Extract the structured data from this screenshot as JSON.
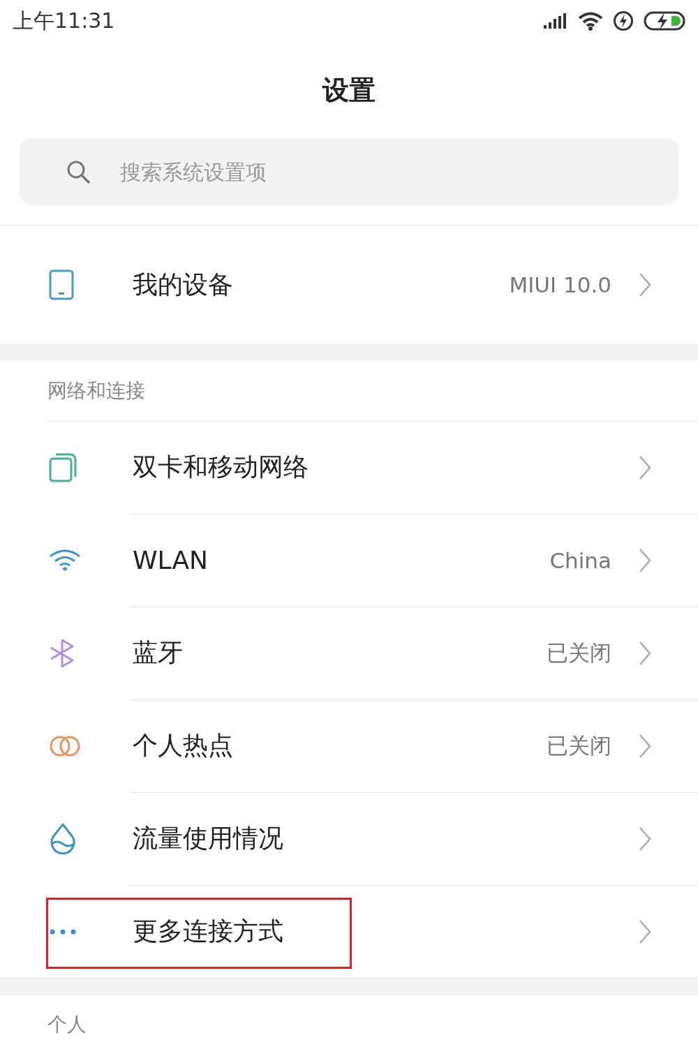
{
  "status_bar": {
    "time": "上午11:31"
  },
  "title": "设置",
  "search": {
    "placeholder": "搜索系统设置项"
  },
  "device": {
    "label": "我的设备",
    "value": "MIUI 10.0"
  },
  "sections": [
    {
      "header": "网络和连接",
      "items": [
        {
          "label": "双卡和移动网络",
          "highlighted": false
        },
        {
          "label": "WLAN",
          "value": "China",
          "highlighted": false
        },
        {
          "label": "蓝牙",
          "value": "已关闭",
          "highlighted": false
        },
        {
          "label": "个人热点",
          "value": "已关闭",
          "highlighted": false
        },
        {
          "label": "流量使用情况",
          "highlighted": false
        },
        {
          "label": "更多连接方式",
          "highlighted": true
        }
      ]
    },
    {
      "header": "个人"
    }
  ]
}
